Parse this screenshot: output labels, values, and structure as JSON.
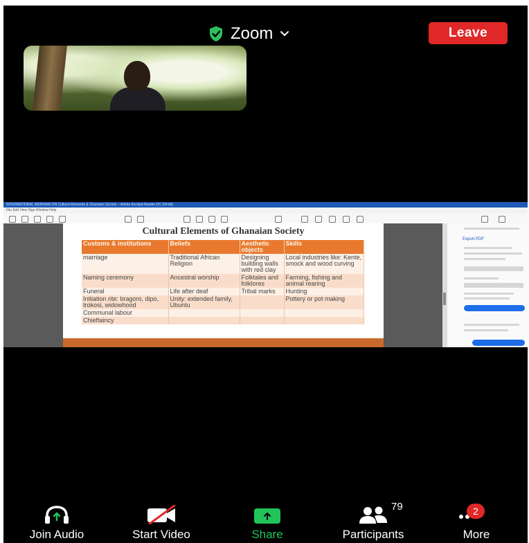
{
  "meeting": {
    "app_title": "Zoom",
    "leave_label": "Leave",
    "colors": {
      "shield": "#2ec05a",
      "leave": "#e02828",
      "share_active": "#21c35a"
    }
  },
  "shared_window": {
    "title_text": "INTERNATIONAL WEBINAR ON Cultural Elements & Ghanaian Society – Adobe Acrobat Reader DC (64-bit)",
    "menu_text": "File  Edit  View  Sign  Window  Help",
    "side_panel": {
      "export_label": "Export PDF"
    },
    "slide": {
      "title": "Cultural Elements of Ghanaian Society",
      "columns": [
        "Customs & institutions",
        "Beliefs",
        "Aesthetic objects",
        "Skills"
      ],
      "rows": [
        [
          "marriage",
          "Traditional African Religion",
          "Designing building walls with red clay",
          "Local industries like: Kente, smock and wood curving"
        ],
        [
          "Naming ceremony",
          "Ancestral worship",
          "Folktales and folklores",
          "Farming, fishing and animal rearing"
        ],
        [
          "Funeral",
          "Life after deaf",
          "Tribal marks",
          "Hunting"
        ],
        [
          "Initiation rite: bragoro, dipo, trokosi, widowhood",
          "Unity: extended family, Ubuntu",
          "",
          "Pottery or pot making"
        ],
        [
          "Communal labour",
          "",
          "",
          ""
        ],
        [
          "Chieftaincy",
          "",
          "",
          ""
        ]
      ]
    }
  },
  "bottom_bar": {
    "join_audio": "Join Audio",
    "start_video": "Start Video",
    "share": "Share",
    "participants": "Participants",
    "participants_count": "79",
    "more": "More",
    "more_badge": "2"
  }
}
